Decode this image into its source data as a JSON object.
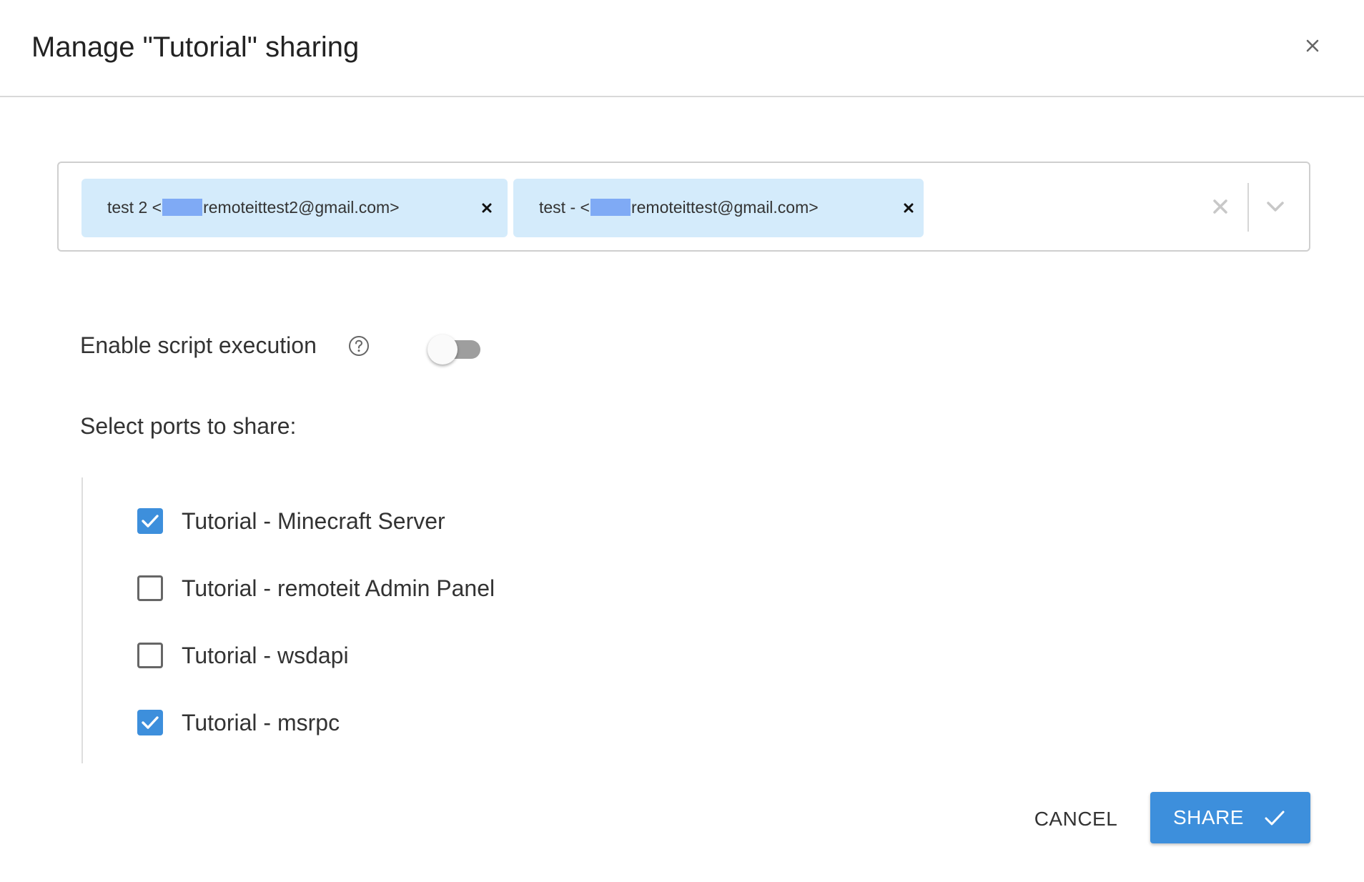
{
  "dialog": {
    "title": "Manage \"Tutorial\" sharing",
    "close_icon": "close-icon"
  },
  "recipients": {
    "chips": [
      {
        "prefix": "test 2 <",
        "suffix": "remoteittest2@gmail.com>",
        "remove_icon": "close-icon"
      },
      {
        "prefix": "test - <",
        "suffix": "remoteittest@gmail.com>",
        "remove_icon": "close-icon"
      }
    ],
    "clear_icon": "close-icon",
    "dropdown_icon": "chevron-down-icon",
    "chip_color": "#d4ebfb",
    "redaction_color": "#7faaf5"
  },
  "script_execution": {
    "label": "Enable script execution",
    "help_icon": "help-circle-icon",
    "enabled": false
  },
  "ports": {
    "label": "Select ports to share:",
    "items": [
      {
        "label": "Tutorial - Minecraft Server",
        "checked": true
      },
      {
        "label": "Tutorial - remoteit Admin Panel",
        "checked": false
      },
      {
        "label": "Tutorial - wsdapi",
        "checked": false
      },
      {
        "label": "Tutorial - msrpc",
        "checked": true
      }
    ]
  },
  "actions": {
    "cancel_label": "CANCEL",
    "share_label": "SHARE",
    "share_icon": "check-icon",
    "accent_color": "#3d8fdc"
  }
}
